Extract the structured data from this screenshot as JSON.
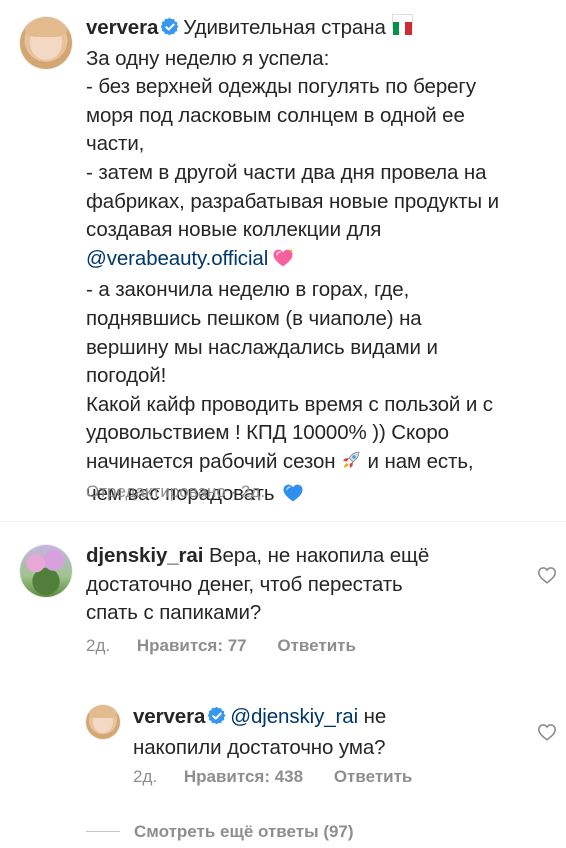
{
  "post": {
    "username": "ververa",
    "location_text": "Удивительная страна",
    "caption_lines": [
      "За одну неделю я успела:",
      "- без верхней одежды погулять по берегу",
      "моря под ласковым солнцем в одной ее",
      "части,",
      "- затем в другой части два дня провела на",
      "фабриках, разрабатывая новые продукты и",
      "создавая новые коллекции  для",
      "- а закончила неделю в горах, где,",
      "поднявшись пешком (в чиаполе) на",
      "вершину  мы наслаждались видами и",
      "погодой!",
      "Какой кайф проводить время с пользой и с",
      "удовольствием ! КПД 10000% )) Скоро",
      "начинается рабочий сезон",
      "и нам есть,",
      "чем вас порадовать"
    ],
    "mention": "@verabeauty.official",
    "edited_label": "Отредактировано",
    "edited_time": "· 2д.",
    "flag_colors": [
      "#009246",
      "#ffffff",
      "#ce2b37"
    ],
    "emoji": {
      "pink_heart": "sparkling-heart-icon",
      "rocket": "rocket-icon",
      "blue_heart": "blue-heart-icon"
    }
  },
  "comments": [
    {
      "username": "djenskiy_rai",
      "lines": [
        "Вера, не накопила ещё",
        "достаточно денег, чтоб перестать",
        "спать с папиками?"
      ],
      "time": "2д.",
      "likes": "Нравится: 77",
      "reply": "Ответить"
    },
    {
      "username": "ververa",
      "mention": "@djenskiy_rai",
      "lines": [
        "не",
        "накопили достаточно ума?"
      ],
      "time": "2д.",
      "likes": "Нравится: 438",
      "reply": "Ответить"
    }
  ],
  "view_more": "Смотреть ещё ответы (97)",
  "colors": {
    "verified_blue": "#3897f0",
    "mention": "#00376b",
    "muted": "#8e8e8e"
  }
}
